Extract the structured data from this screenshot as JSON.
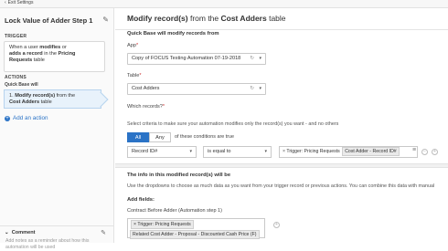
{
  "topbar": {
    "exit_label": "Exit Settings"
  },
  "sidebar": {
    "title": "Lock Value of Adder Step 1",
    "trigger_label": "TRIGGER",
    "trigger_text": {
      "p1": "When a user ",
      "b1": "modifies",
      "p2": " or",
      "p3": "adds a record",
      "p4": " in the ",
      "b2": "Pricing",
      "b3": "Requests",
      "p5": " table"
    },
    "actions_label": "ACTIONS",
    "quickbase_will": "Quick Base will",
    "action_item": {
      "p1": "1. ",
      "b1": "Modify record(s)",
      "p2": " from the",
      "b2": "Cost Adders",
      "p3": " table"
    },
    "add_action": "Add an action",
    "comment": {
      "label": "Comment",
      "placeholder": "Add notes as a reminder about how this automation will be used"
    }
  },
  "main": {
    "title_pre": "Modify record(s)",
    "title_mid": " from the ",
    "title_bold": "Cost Adders",
    "title_post": " table",
    "qb_modify_from": "Quick Base will modify records from",
    "app": {
      "label": "App",
      "value": "Copy of FOCUS Testing Automation 07-19-2018"
    },
    "table": {
      "label": "Table",
      "value": "Cost Adders"
    },
    "which_records": "Which records?",
    "help_text": "Select criteria to make sure your automation modifies only the record(s) you want - and no others",
    "match": {
      "all": "All",
      "any": "Any",
      "suffix": "of these conditions are true"
    },
    "condition": {
      "field": "Record ID#",
      "operator": "is equal to",
      "token_x": "×",
      "token_source": "Trigger: Pricing Requests",
      "token_field": "Cost Adder - Record ID#"
    },
    "info_title": "The info in this modified record(s) will be",
    "info_text": "Use the dropdowns to choose as much data as you want from your trigger record or previous actions. You can combine this data with manual",
    "add_fields": "Add fields:",
    "contract_label": "Contract Before Adder (Automation step 1)",
    "fx": {
      "token_source": "Trigger: Pricing Requests",
      "token_field": "Related Cost Adder - Proposal - Discounted Cash Price (F)"
    }
  }
}
